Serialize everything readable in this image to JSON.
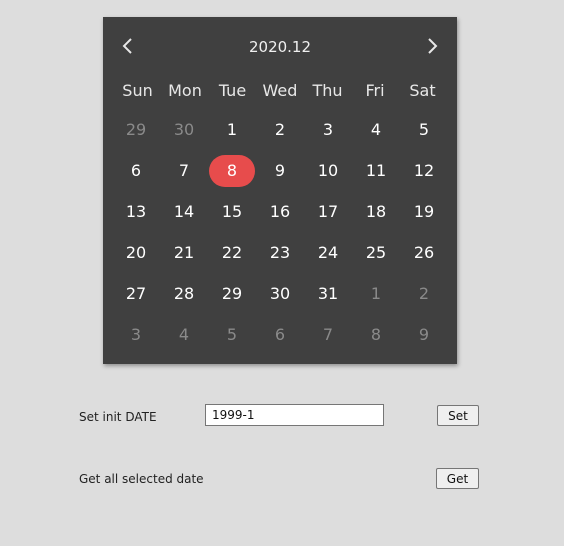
{
  "calendar": {
    "title": "2020.12",
    "prev_icon": "chevron-left-icon",
    "next_icon": "chevron-right-icon",
    "weekdays": [
      "Sun",
      "Mon",
      "Tue",
      "Wed",
      "Thu",
      "Fri",
      "Sat"
    ],
    "selected_color": "#e74c4c",
    "weeks": [
      [
        {
          "d": "29",
          "other": true
        },
        {
          "d": "30",
          "other": true
        },
        {
          "d": "1"
        },
        {
          "d": "2"
        },
        {
          "d": "3"
        },
        {
          "d": "4"
        },
        {
          "d": "5"
        }
      ],
      [
        {
          "d": "6"
        },
        {
          "d": "7"
        },
        {
          "d": "8",
          "selected": true
        },
        {
          "d": "9"
        },
        {
          "d": "10"
        },
        {
          "d": "11"
        },
        {
          "d": "12"
        }
      ],
      [
        {
          "d": "13"
        },
        {
          "d": "14"
        },
        {
          "d": "15"
        },
        {
          "d": "16"
        },
        {
          "d": "17"
        },
        {
          "d": "18"
        },
        {
          "d": "19"
        }
      ],
      [
        {
          "d": "20"
        },
        {
          "d": "21"
        },
        {
          "d": "22"
        },
        {
          "d": "23"
        },
        {
          "d": "24"
        },
        {
          "d": "25"
        },
        {
          "d": "26"
        }
      ],
      [
        {
          "d": "27"
        },
        {
          "d": "28"
        },
        {
          "d": "29"
        },
        {
          "d": "30"
        },
        {
          "d": "31"
        },
        {
          "d": "1",
          "other": true
        },
        {
          "d": "2",
          "other": true
        }
      ],
      [
        {
          "d": "3",
          "other": true
        },
        {
          "d": "4",
          "other": true
        },
        {
          "d": "5",
          "other": true
        },
        {
          "d": "6",
          "other": true
        },
        {
          "d": "7",
          "other": true
        },
        {
          "d": "8",
          "other": true
        },
        {
          "d": "9",
          "other": true
        }
      ]
    ]
  },
  "set_row": {
    "label": "Set init DATE",
    "input_value": "1999-1",
    "button_label": "Set"
  },
  "get_row": {
    "label": "Get all selected date",
    "button_label": "Get"
  }
}
